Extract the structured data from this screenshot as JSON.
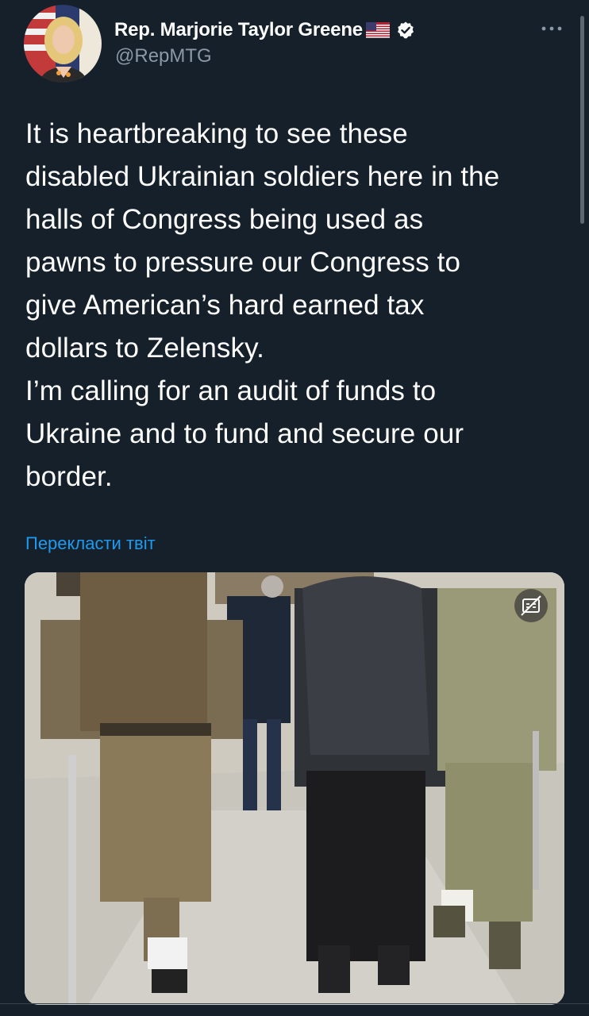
{
  "account": {
    "display_name": "Rep. Marjorie Taylor Greene",
    "handle": "@RepMTG",
    "flag_icon": "us-flag-icon",
    "verified_icon": "verified-badge-icon"
  },
  "tweet": {
    "text": "It is heartbreaking to see these\ndisabled Ukrainian soldiers here in the\nhalls of Congress being used as\npawns to pressure our Congress to\ngive American’s hard earned tax\ndollars to Zelensky.\nI’m calling for an audit of funds to\nUkraine and to fund and secure our\nborder.",
    "translate_label": "Перекласти твіт"
  },
  "media": {
    "type": "video",
    "caption_toggle_icon": "closed-captions-icon"
  },
  "colors": {
    "background": "#15202b",
    "text_primary": "#ffffff",
    "text_secondary": "#8b98a5",
    "accent": "#1d9bf0"
  }
}
